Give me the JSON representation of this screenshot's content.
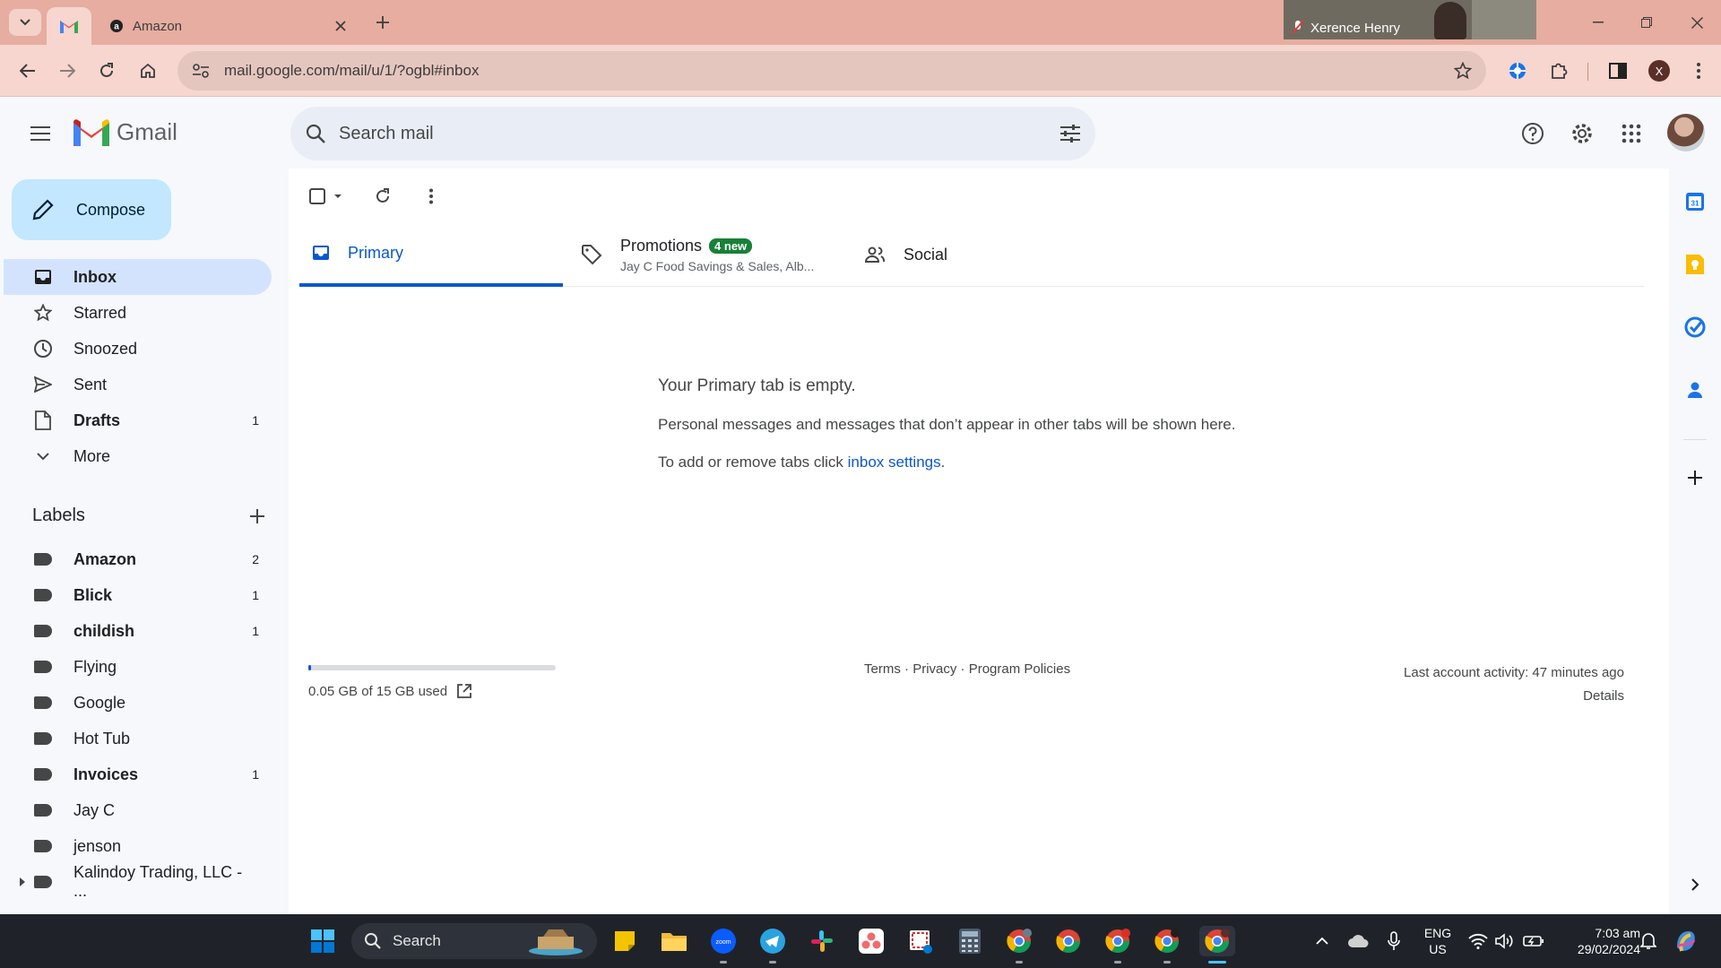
{
  "browser": {
    "tabs": [
      {
        "title": "",
        "icon": "gmail-favicon"
      },
      {
        "title": "Amazon",
        "icon": "amazon-favicon"
      }
    ],
    "url": "mail.google.com/mail/u/1/?ogbl#inbox",
    "profile_initial": "X"
  },
  "zoom_overlay": {
    "name": "Xerence Henry"
  },
  "gmail": {
    "logo_text": "Gmail",
    "search_placeholder": "Search mail",
    "compose_label": "Compose",
    "nav": [
      {
        "label": "Inbox",
        "count": "",
        "icon": "inbox-icon",
        "active": true
      },
      {
        "label": "Starred",
        "count": "",
        "icon": "star-icon"
      },
      {
        "label": "Snoozed",
        "count": "",
        "icon": "clock-icon"
      },
      {
        "label": "Sent",
        "count": "",
        "icon": "send-icon"
      },
      {
        "label": "Drafts",
        "count": "1",
        "icon": "draft-icon",
        "bold": true
      },
      {
        "label": "More",
        "count": "",
        "icon": "chevron-down-icon"
      }
    ],
    "labels_title": "Labels",
    "labels": [
      {
        "label": "Amazon",
        "count": "2",
        "bold": true
      },
      {
        "label": "Blick",
        "count": "1",
        "bold": true
      },
      {
        "label": "childish",
        "count": "1",
        "bold": true
      },
      {
        "label": "Flying",
        "count": ""
      },
      {
        "label": "Google",
        "count": ""
      },
      {
        "label": "Hot Tub",
        "count": ""
      },
      {
        "label": "Invoices",
        "count": "1",
        "bold": true
      },
      {
        "label": "Jay C",
        "count": ""
      },
      {
        "label": "jenson",
        "count": ""
      },
      {
        "label": "Kalindoy Trading, LLC - ...",
        "count": ""
      }
    ],
    "tabs": {
      "primary": "Primary",
      "promotions": "Promotions",
      "promotions_badge": "4 new",
      "promotions_snippet": "Jay C Food Savings & Sales, Alb...",
      "social": "Social"
    },
    "empty": {
      "heading": "Your Primary tab is empty.",
      "message": "Personal messages and messages that don’t appear in other tabs will be shown here.",
      "settings_prefix": "To add or remove tabs click ",
      "settings_link": "inbox settings",
      "settings_suffix": "."
    },
    "storage": {
      "text": "0.05 GB of 15 GB used",
      "used_fraction": 0.0033
    },
    "footer": {
      "terms": "Terms",
      "privacy": "Privacy",
      "policies": "Program Policies",
      "sep": " · "
    },
    "activity": {
      "text": "Last account activity: 47 minutes ago",
      "details": "Details"
    }
  },
  "taskbar": {
    "search_label": "Search",
    "lang": "ENG",
    "region": "US",
    "time": "7:03 am",
    "date": "29/02/2024"
  },
  "colors": {
    "accent": "#0b57d0",
    "compose_bg": "#c2e7ff",
    "inbox_active_bg": "#d3e3fd",
    "promo_badge": "#188038",
    "titlebar": "#e6ada0"
  }
}
